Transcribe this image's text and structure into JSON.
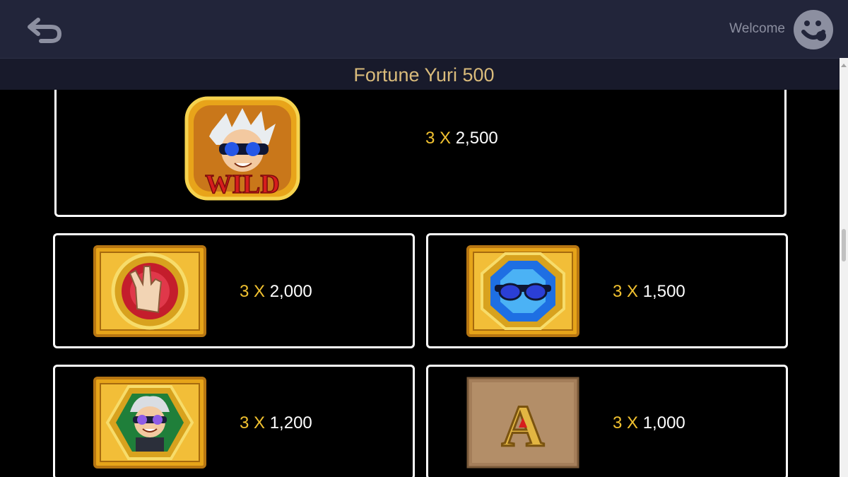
{
  "header": {
    "welcome_label": "Welcome",
    "back_icon": "back-arrow-icon",
    "avatar_icon": "user-avatar-icon"
  },
  "title": "Fortune Yuri 500",
  "colors": {
    "topbar_bg": "#22253a",
    "titlebar_bg": "#181a2b",
    "title_gold": "#d9bb7b",
    "multiplier_yellow": "#f2c230"
  },
  "paytable": [
    {
      "symbol": "wild-symbol",
      "symbol_text": "WILD",
      "multiplier": "3 X",
      "amount": "2,500"
    },
    {
      "symbol": "hand-gesture-symbol",
      "multiplier": "3 X",
      "amount": "2,000"
    },
    {
      "symbol": "sunglasses-gem-symbol",
      "multiplier": "3 X",
      "amount": "1,500"
    },
    {
      "symbol": "yuri-character-symbol",
      "multiplier": "3 X",
      "amount": "1,200"
    },
    {
      "symbol": "letter-a-symbol",
      "symbol_text": "A",
      "multiplier": "3 X",
      "amount": "1,000"
    }
  ]
}
